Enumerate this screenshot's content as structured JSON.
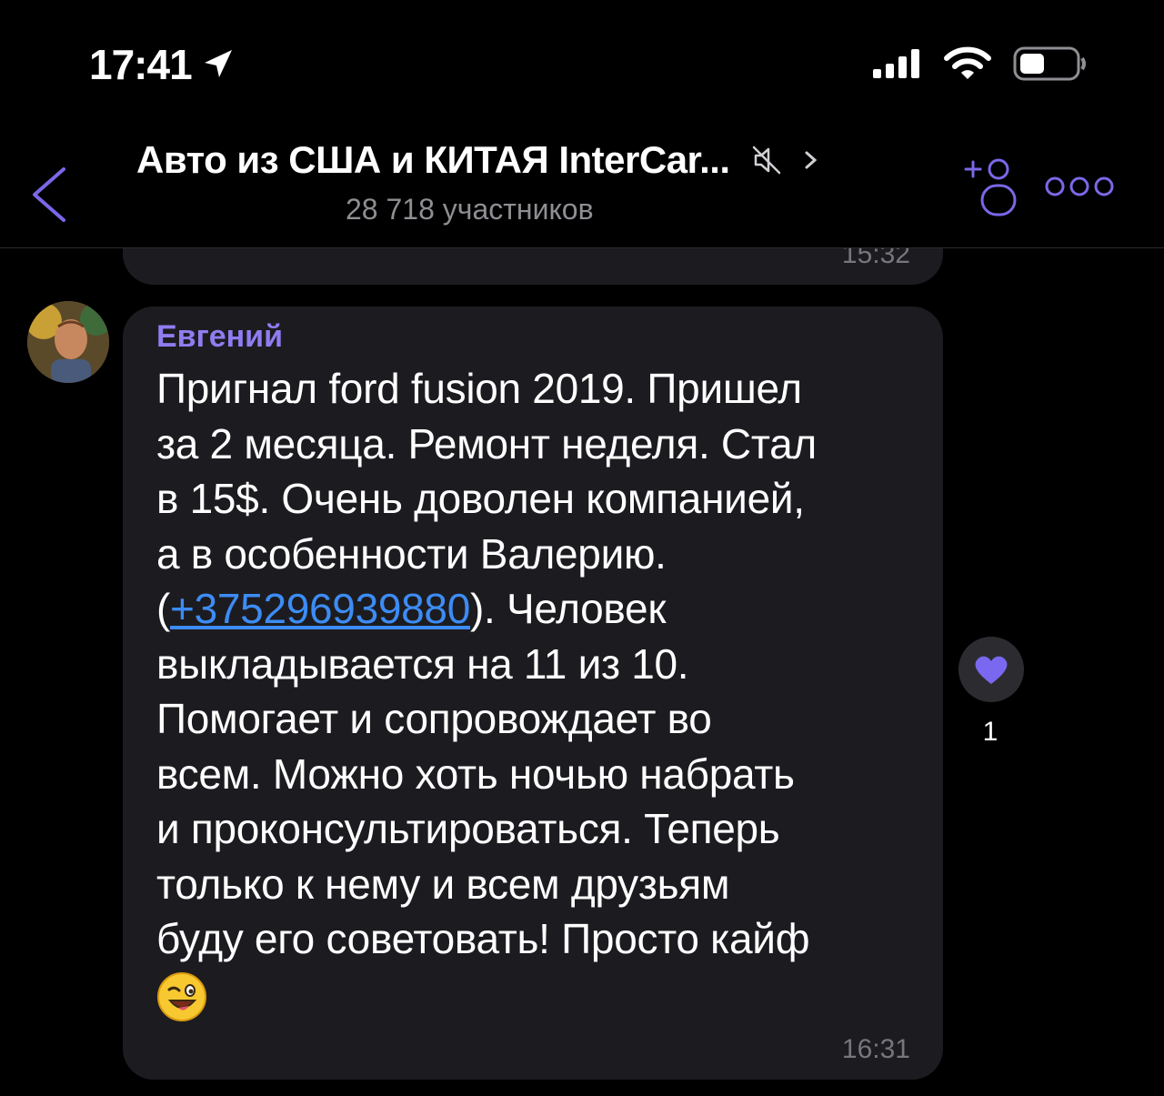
{
  "status_bar": {
    "time": "17:41"
  },
  "header": {
    "title": "Авто из США и КИТАЯ InterCar...",
    "members": "28 718 участников"
  },
  "previous_message": {
    "time": "15:32"
  },
  "message": {
    "sender": "Евгений",
    "lines": [
      "Пригнал ford fusion 2019. Пришел",
      "за 2 месяца. Ремонт неделя. Стал",
      "в 15$. Очень доволен компанией,",
      "а в особенности Валерию."
    ],
    "phone_prefix": "(",
    "phone": "+375296939880",
    "phone_suffix": "). Человек",
    "lines_after": [
      "выкладывается на 11 из 10.",
      "Помогает и сопровождает во",
      "всем. Можно хоть ночью набрать",
      "и проконсультироваться. Теперь",
      "только к нему и всем друзьям",
      "буду его советовать! Просто кайф"
    ],
    "time": "16:31"
  },
  "reaction": {
    "icon": "purple-heart-icon",
    "count": "1"
  },
  "colors": {
    "accent": "#8f7df0",
    "link": "#3d8cf5",
    "bubble": "#1c1c20",
    "background": "#000000"
  }
}
